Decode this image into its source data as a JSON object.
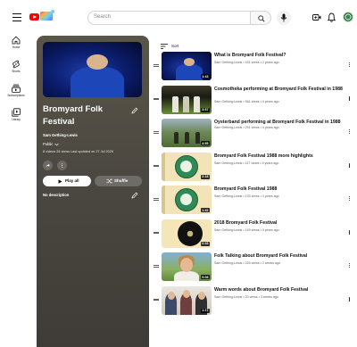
{
  "topbar": {
    "search_placeholder": "Search"
  },
  "guide": {
    "items": [
      {
        "label": "Home",
        "icon": "home-icon"
      },
      {
        "label": "Shorts",
        "icon": "shorts-icon"
      },
      {
        "label": "Subscriptions",
        "icon": "subscriptions-icon"
      },
      {
        "label": "Library",
        "icon": "library-icon"
      }
    ]
  },
  "playlist": {
    "title": "Bromyard Folk Festival",
    "owner": "Sam Gething-Lewis",
    "privacy": "Public",
    "stats": "8 videos   25 views   Last updated on 27 Jul 2020",
    "play_all": "Play all",
    "shuffle": "Shuffle",
    "description": "No description"
  },
  "sort_label": "Sort",
  "videos": [
    {
      "title": "What is Bromyard Folk Festival?",
      "meta": "Sam Gething-Lewis • 431 views • 2 years ago",
      "duration": "1:43"
    },
    {
      "title": "Cosmotheka performing at Bromyard Folk Festival in 1988",
      "meta": "Sam Gething-Lewis • 561 views • 4 years ago",
      "duration": "3:57"
    },
    {
      "title": "Oysterband performing at Bromyard Folk Festival in 1988",
      "meta": "Sam Gething-Lewis • 291 views • 4 years ago",
      "duration": "4:55"
    },
    {
      "title": "Bromyard Folk Festival 1988 more highlights",
      "meta": "Sam Gething-Lewis • 117 views • 4 years ago",
      "duration": "2:18"
    },
    {
      "title": "Bromyard Folk Festival 1988",
      "meta": "Sam Gething-Lewis • 133 views • 4 years ago",
      "duration": "1:32"
    },
    {
      "title": "2018 Bromyard Folk Festival",
      "meta": "Sam Gething-Lewis • 149 views • 5 years ago",
      "duration": "0:33"
    },
    {
      "title": "Folk Talking about Bromyard Folk Festival",
      "meta": "Sam Gething-Lewis • 225 views • 2 weeks ago",
      "duration": "9:08"
    },
    {
      "title": "Warm words about Bromyard Folk Festival",
      "meta": "Sam Gething-Lewis • 20 views • 3 weeks ago",
      "duration": "1:17"
    }
  ],
  "colors": {
    "brand_red": "#ff0000",
    "panel_top": "#5a5549",
    "panel_bottom": "#3f3c37",
    "meta_text": "#606060"
  }
}
